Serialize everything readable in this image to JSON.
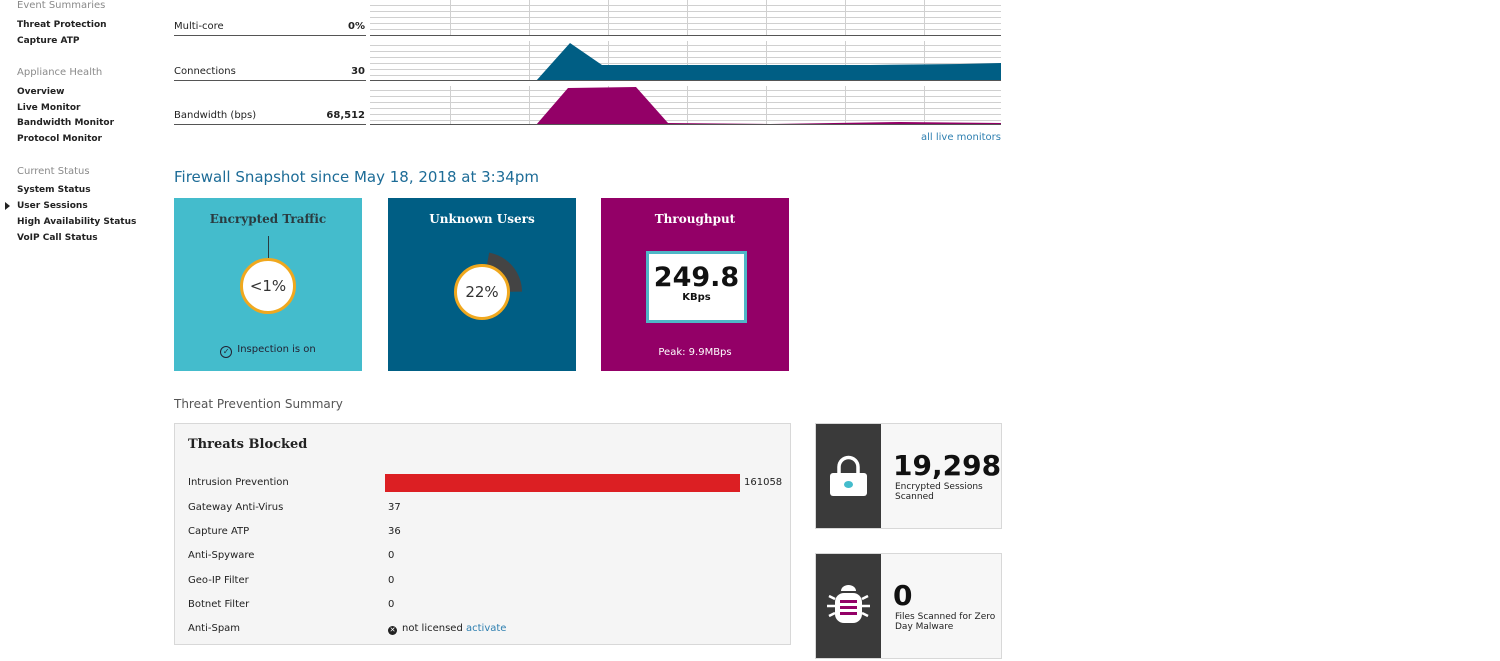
{
  "sidebar": {
    "event_summaries": {
      "title": "Event Summaries",
      "items": [
        "Threat Protection",
        "Capture ATP"
      ]
    },
    "appliance_health": {
      "title": "Appliance Health",
      "items": [
        "Overview",
        "Live Monitor",
        "Bandwidth Monitor",
        "Protocol Monitor"
      ]
    },
    "current_status": {
      "title": "Current Status",
      "items": [
        "System Status",
        "User Sessions",
        "High Availability Status",
        "VoIP Call Status"
      ],
      "selected": "User Sessions"
    }
  },
  "live_monitors": {
    "rows": [
      {
        "label": "Multi-core",
        "value": "0%"
      },
      {
        "label": "Connections",
        "value": "30"
      },
      {
        "label": "Bandwidth (bps)",
        "value": "68,512"
      }
    ],
    "all_link": "all live monitors",
    "colors": {
      "connections": "#005e84",
      "bandwidth": "#930067"
    }
  },
  "snapshot": {
    "title": "Firewall Snapshot since May 18, 2018 at 3:34pm",
    "encrypted": {
      "title": "Encrypted Traffic",
      "value": "<1%",
      "status": "Inspection is on",
      "status_icon": "check-circle-icon",
      "color": "#44bccc"
    },
    "unknown_users": {
      "title": "Unknown Users",
      "value": "22%",
      "fraction": 0.22,
      "color": "#005e84"
    },
    "throughput": {
      "title": "Throughput",
      "value": "249.8",
      "unit": "KBps",
      "peak": "Peak: 9.9MBps",
      "color": "#930067"
    }
  },
  "threat_summary": {
    "title": "Threat Prevention Summary",
    "panel_title": "Threats Blocked",
    "rows": [
      {
        "name": "Intrusion Prevention",
        "value": "161058",
        "bar_color": "#dc1f23"
      },
      {
        "name": "Gateway Anti-Virus",
        "value": "37"
      },
      {
        "name": "Capture ATP",
        "value": "36"
      },
      {
        "name": "Anti-Spyware",
        "value": "0"
      },
      {
        "name": "Geo-IP Filter",
        "value": "0"
      },
      {
        "name": "Botnet Filter",
        "value": "0"
      },
      {
        "name": "Anti-Spam",
        "value": "not licensed",
        "action": "activate",
        "icon": "x-circle-icon"
      }
    ]
  },
  "stats": [
    {
      "number": "19,298",
      "label": "Encrypted Sessions Scanned",
      "icon": "lock-icon"
    },
    {
      "number": "0",
      "label": "Files Scanned for Zero Day Malware",
      "icon": "bug-icon"
    }
  ]
}
